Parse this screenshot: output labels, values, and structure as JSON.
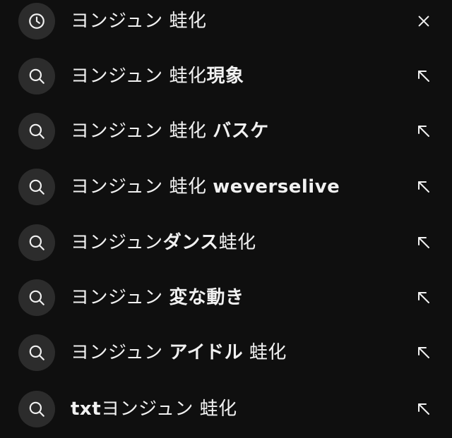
{
  "suggestions": [
    {
      "type": "history",
      "lead_icon": "clock-icon",
      "trail_icon": "close-icon",
      "parts": [
        {
          "text": "ヨンジュン 蛙化",
          "bold": false
        }
      ]
    },
    {
      "type": "search",
      "lead_icon": "search-icon",
      "trail_icon": "arrow-up-left-icon",
      "parts": [
        {
          "text": "ヨンジュン 蛙化",
          "bold": false
        },
        {
          "text": "現象",
          "bold": true
        }
      ]
    },
    {
      "type": "search",
      "lead_icon": "search-icon",
      "trail_icon": "arrow-up-left-icon",
      "parts": [
        {
          "text": "ヨンジュン 蛙化 ",
          "bold": false
        },
        {
          "text": "バスケ",
          "bold": true
        }
      ]
    },
    {
      "type": "search",
      "lead_icon": "search-icon",
      "trail_icon": "arrow-up-left-icon",
      "parts": [
        {
          "text": "ヨンジュン 蛙化 ",
          "bold": false
        },
        {
          "text": "weverselive",
          "bold": true
        }
      ]
    },
    {
      "type": "search",
      "lead_icon": "search-icon",
      "trail_icon": "arrow-up-left-icon",
      "parts": [
        {
          "text": "ヨンジュン",
          "bold": false
        },
        {
          "text": "ダンス",
          "bold": true
        },
        {
          "text": "蛙化",
          "bold": false
        }
      ]
    },
    {
      "type": "search",
      "lead_icon": "search-icon",
      "trail_icon": "arrow-up-left-icon",
      "parts": [
        {
          "text": "ヨンジュン ",
          "bold": false
        },
        {
          "text": "変な動き",
          "bold": true
        }
      ]
    },
    {
      "type": "search",
      "lead_icon": "search-icon",
      "trail_icon": "arrow-up-left-icon",
      "parts": [
        {
          "text": "ヨンジュン ",
          "bold": false
        },
        {
          "text": "アイドル",
          "bold": true
        },
        {
          "text": " 蛙化",
          "bold": false
        }
      ]
    },
    {
      "type": "search",
      "lead_icon": "search-icon",
      "trail_icon": "arrow-up-left-icon",
      "parts": [
        {
          "text": "txt",
          "bold": true
        },
        {
          "text": "ヨンジュン 蛙化",
          "bold": false
        }
      ]
    }
  ],
  "colors": {
    "background": "#0f0f0f",
    "icon_bg": "#2c2c2c",
    "text": "#f1f1f1",
    "icon": "#f1f1f1"
  }
}
